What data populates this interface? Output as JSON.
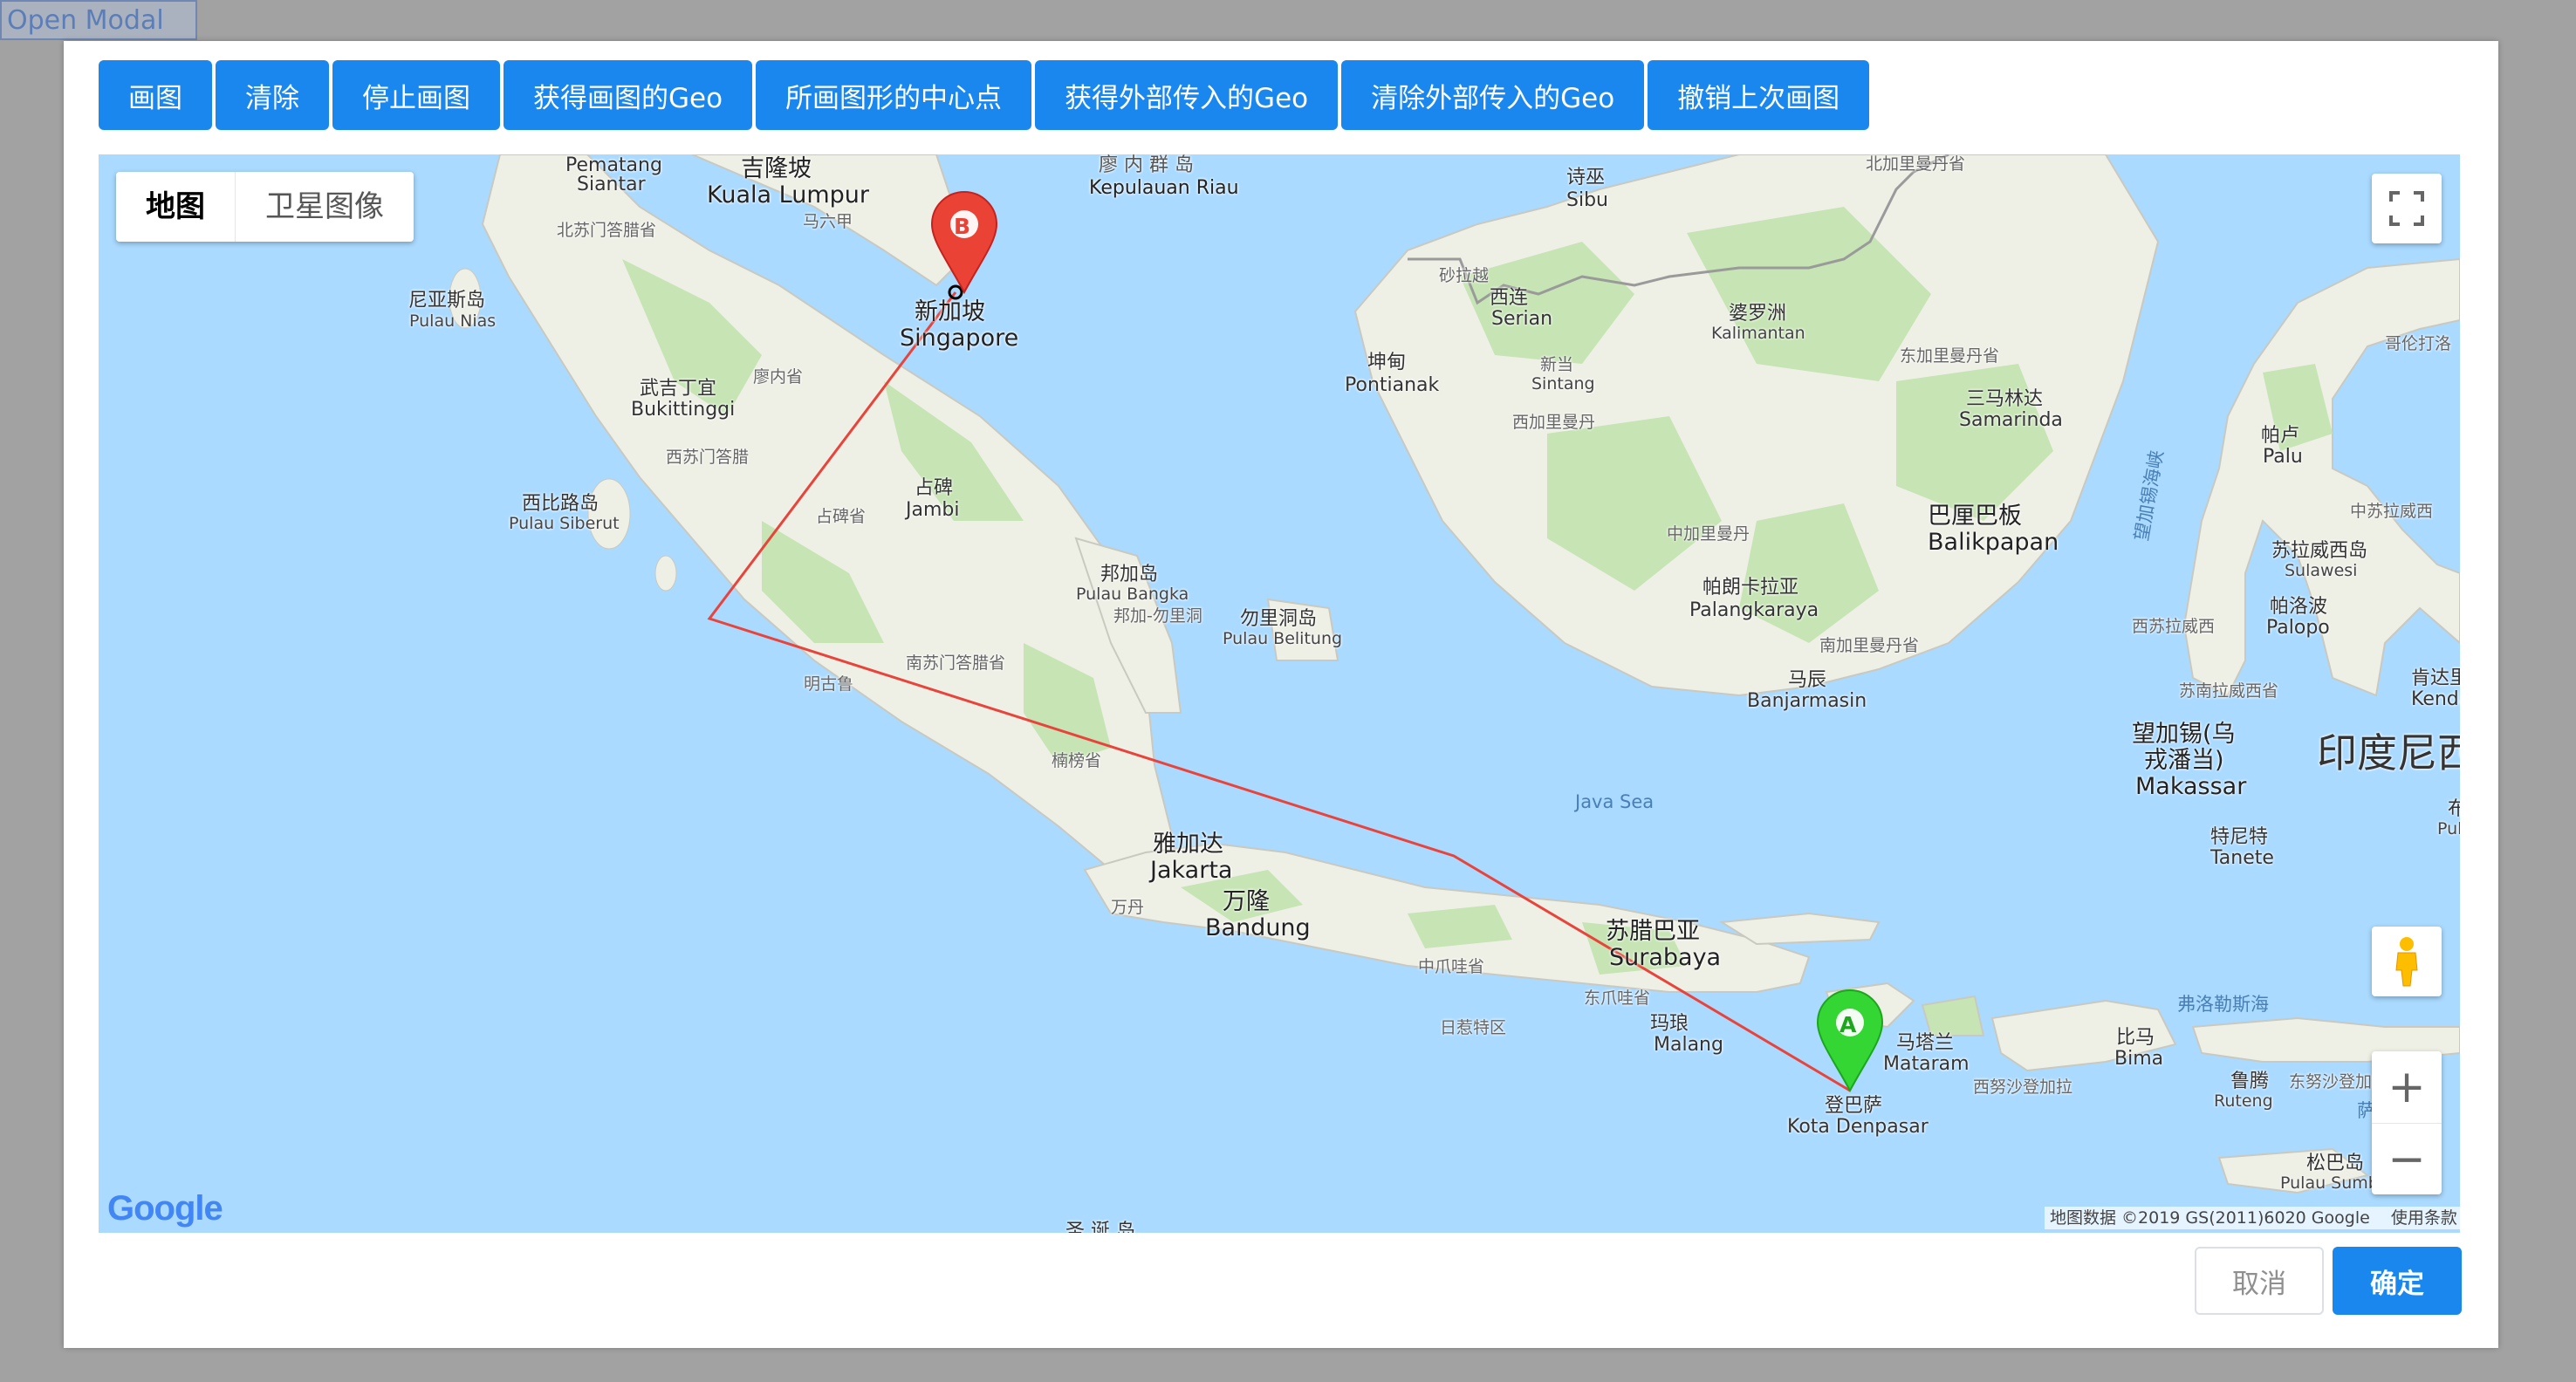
{
  "open_modal_label": "Open Modal",
  "toolbar": {
    "buttons": [
      "画图",
      "清除",
      "停止画图",
      "获得画图的Geo",
      "所画图形的中心点",
      "获得外部传入的Geo",
      "清除外部传入的Geo",
      "撤销上次画图"
    ]
  },
  "map": {
    "type_control": {
      "map_label": "地图",
      "satellite_label": "卫星图像"
    },
    "zoom_in_label": "+",
    "zoom_out_label": "−",
    "fullscreen_icon": "fullscreen-icon",
    "pegman_icon": "pegman-icon",
    "google_logo": "Google",
    "attribution": "地图数据 ©2019 GS(2011)6020 Google",
    "terms": "使用条款",
    "markers": {
      "a": "A",
      "b": "B"
    },
    "labels": {
      "pematang": "Pematang",
      "siantar": "Siantar",
      "kl_cn": "吉隆坡",
      "kl_en": "Kuala Lumpur",
      "malacca": "马六甲",
      "riau_cn": "廖 内 群 岛",
      "riau_en": "Kepulauan Riau",
      "north_sumatra": "北苏门答腊省",
      "nias_cn": "尼亚斯岛",
      "nias_en": "Pulau Nias",
      "sg_cn": "新加坡",
      "sg_en": "Singapore",
      "bukit_cn": "武吉丁宜",
      "bukit_en": "Bukittinggi",
      "riau_prov": "廖内省",
      "west_sumatra": "西苏门答腊",
      "siberut_cn": "西比路岛",
      "siberut_en": "Pulau Siberut",
      "jambi_cn": "占碑",
      "jambi_en": "Jambi",
      "jambi_prov": "占碑省",
      "bangka_cn": "邦加岛",
      "bangka_en": "Pulau Bangka",
      "bangka_prov": "邦加-勿里洞",
      "belitung_cn": "勿里洞岛",
      "belitung_en": "Pulau Belitung",
      "south_sumatra": "南苏门答腊省",
      "bengkulu": "明古鲁",
      "lampung": "楠榜省",
      "jakarta_cn": "雅加达",
      "jakarta_en": "Jakarta",
      "bandung_cn": "万隆",
      "bandung_en": "Bandung",
      "banten": "万丹",
      "central_java": "中爪哇省",
      "east_java": "东爪哇省",
      "yogya": "日惹特区",
      "surabaya_cn": "苏腊巴亚",
      "surabaya_en": "Surabaya",
      "malang_cn": "玛琅",
      "malang_en": "Malang",
      "denpasar_cn": "登巴萨",
      "denpasar_en": "Kota Denpasar",
      "mataram_cn": "马塔兰",
      "mataram_en": "Mataram",
      "ntb": "西努沙登加拉",
      "bima_cn": "比马",
      "bima_en": "Bima",
      "ruteng_cn": "鲁腾",
      "ruteng_en": "Ruteng",
      "ntt": "东努沙登加拉",
      "sumba_cn": "松巴岛",
      "sumba_en": "Pulau Sumba",
      "java_sea": "Java Sea",
      "flores_sea": "弗洛勒斯海",
      "sibu_cn": "诗巫",
      "sibu_en": "Sibu",
      "sarawak": "砂拉越",
      "serian_cn": "西连",
      "serian_en": "Serian",
      "kalimantan_cn": "婆罗洲",
      "kalimantan_en": "Kalimantan",
      "pontianak_cn": "坤甸",
      "pontianak_en": "Pontianak",
      "sintang_cn": "新当",
      "sintang_en": "Sintang",
      "west_kal": "西加里曼丹",
      "east_kal": "东加里曼丹省",
      "north_kal": "北加里曼丹省",
      "samarinda_cn": "三马林达",
      "samarinda_en": "Samarinda",
      "balikpapan_cn": "巴厘巴板",
      "balikpapan_en": "Balikpapan",
      "central_kal": "中加里曼丹",
      "palangkaraya_cn": "帕朗卡拉亚",
      "palangkaraya_en": "Palangkaraya",
      "south_kal": "南加里曼丹省",
      "banjarmasin_cn": "马辰",
      "banjarmasin_en": "Banjarmasin",
      "makassar_strait": "望加锡海峡",
      "gorontalo": "哥伦打洛",
      "palu_cn": "帕卢",
      "palu_en": "Palu",
      "central_sul": "中苏拉威西",
      "sulawesi_cn": "苏拉威西岛",
      "sulawesi_en": "Sulawesi",
      "palopo_cn": "帕洛波",
      "palopo_en": "Palopo",
      "west_sul": "西苏拉威西",
      "south_sul": "苏南拉威西省",
      "kendari_cn": "肯达里",
      "kendari_en": "Kenda",
      "makassar_cn1": "望加锡(乌",
      "makassar_cn2": "戎潘当)",
      "makassar_en": "Makassar",
      "tanete_cn": "特尼特",
      "tanete_en": "Tanete",
      "indonesia_cn": "印度尼西",
      "bu": "布",
      "pula": "Pula",
      "sa": "萨",
      "bottom_cut": "圣 诞 岛"
    }
  },
  "footer": {
    "cancel_label": "取消",
    "ok_label": "确定"
  }
}
